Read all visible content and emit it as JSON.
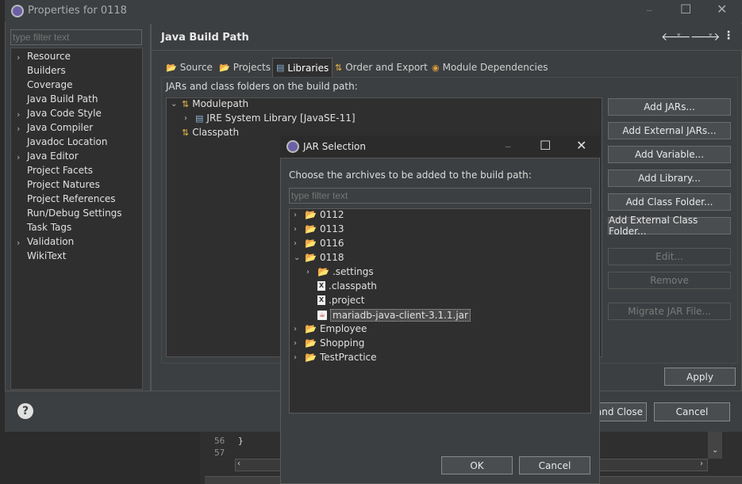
{
  "background_editor": {
    "lines": [
      {
        "no": "56",
        "code": "}"
      },
      {
        "no": "57",
        "code": ""
      }
    ]
  },
  "properties_window": {
    "title": "Properties for 0118",
    "filter_placeholder": "type filter text",
    "nav_items": [
      {
        "label": "Resource",
        "expandable": true
      },
      {
        "label": "Builders",
        "expandable": false
      },
      {
        "label": "Coverage",
        "expandable": false
      },
      {
        "label": "Java Build Path",
        "expandable": false
      },
      {
        "label": "Java Code Style",
        "expandable": true
      },
      {
        "label": "Java Compiler",
        "expandable": true
      },
      {
        "label": "Javadoc Location",
        "expandable": false
      },
      {
        "label": "Java Editor",
        "expandable": true
      },
      {
        "label": "Project Facets",
        "expandable": false
      },
      {
        "label": "Project Natures",
        "expandable": false
      },
      {
        "label": "Project References",
        "expandable": false
      },
      {
        "label": "Run/Debug Settings",
        "expandable": false
      },
      {
        "label": "Task Tags",
        "expandable": false
      },
      {
        "label": "Validation",
        "expandable": true
      },
      {
        "label": "WikiText",
        "expandable": false
      }
    ],
    "page_title": "Java Build Path",
    "tabs": [
      {
        "label": "Source"
      },
      {
        "label": "Projects"
      },
      {
        "label": "Libraries",
        "active": true
      },
      {
        "label": "Order and Export"
      },
      {
        "label": "Module Dependencies"
      }
    ],
    "section_label": "JARs and class folders on the build path:",
    "tree": [
      {
        "label": "Modulepath",
        "depth": 0,
        "expanded": true
      },
      {
        "label": "JRE System Library [JavaSE-11]",
        "depth": 1,
        "expanded": false
      },
      {
        "label": "Classpath",
        "depth": 0,
        "expanded": false
      }
    ],
    "buttons": [
      {
        "label": "Add JARs...",
        "enabled": true
      },
      {
        "label": "Add External JARs...",
        "enabled": true
      },
      {
        "label": "Add Variable...",
        "enabled": true
      },
      {
        "label": "Add Library...",
        "enabled": true
      },
      {
        "label": "Add Class Folder...",
        "enabled": true
      },
      {
        "label": "Add External Class Folder...",
        "enabled": true
      },
      {
        "label": "Edit...",
        "enabled": false
      },
      {
        "label": "Remove",
        "enabled": false
      },
      {
        "label": "Migrate JAR File...",
        "enabled": false
      }
    ],
    "apply_label": "Apply",
    "apply_close_label": "and Close",
    "cancel_label": "Cancel"
  },
  "jar_dialog": {
    "title": "JAR Selection",
    "prompt": "Choose the archives to be added to the build path:",
    "filter_placeholder": "type filter text",
    "tree": [
      {
        "label": "0112",
        "kind": "project",
        "depth": 0,
        "expanded": false
      },
      {
        "label": "0113",
        "kind": "project",
        "depth": 0,
        "expanded": false
      },
      {
        "label": "0116",
        "kind": "project",
        "depth": 0,
        "expanded": false
      },
      {
        "label": "0118",
        "kind": "project",
        "depth": 0,
        "expanded": true
      },
      {
        "label": ".settings",
        "kind": "folder",
        "depth": 1,
        "expanded": false
      },
      {
        "label": ".classpath",
        "kind": "file",
        "depth": 1
      },
      {
        "label": ".project",
        "kind": "file",
        "depth": 1
      },
      {
        "label": "mariadb-java-client-3.1.1.jar",
        "kind": "jar",
        "depth": 1,
        "selected": true
      },
      {
        "label": "Employee",
        "kind": "project",
        "depth": 0,
        "expanded": false
      },
      {
        "label": "Shopping",
        "kind": "project",
        "depth": 0,
        "expanded": false
      },
      {
        "label": "TestPractice",
        "kind": "project",
        "depth": 0,
        "expanded": false
      }
    ],
    "ok_label": "OK",
    "cancel_label": "Cancel"
  },
  "colors": {
    "background": "#3c3f41",
    "panel": "#2f2f2f",
    "folder": "#e8c15c"
  }
}
